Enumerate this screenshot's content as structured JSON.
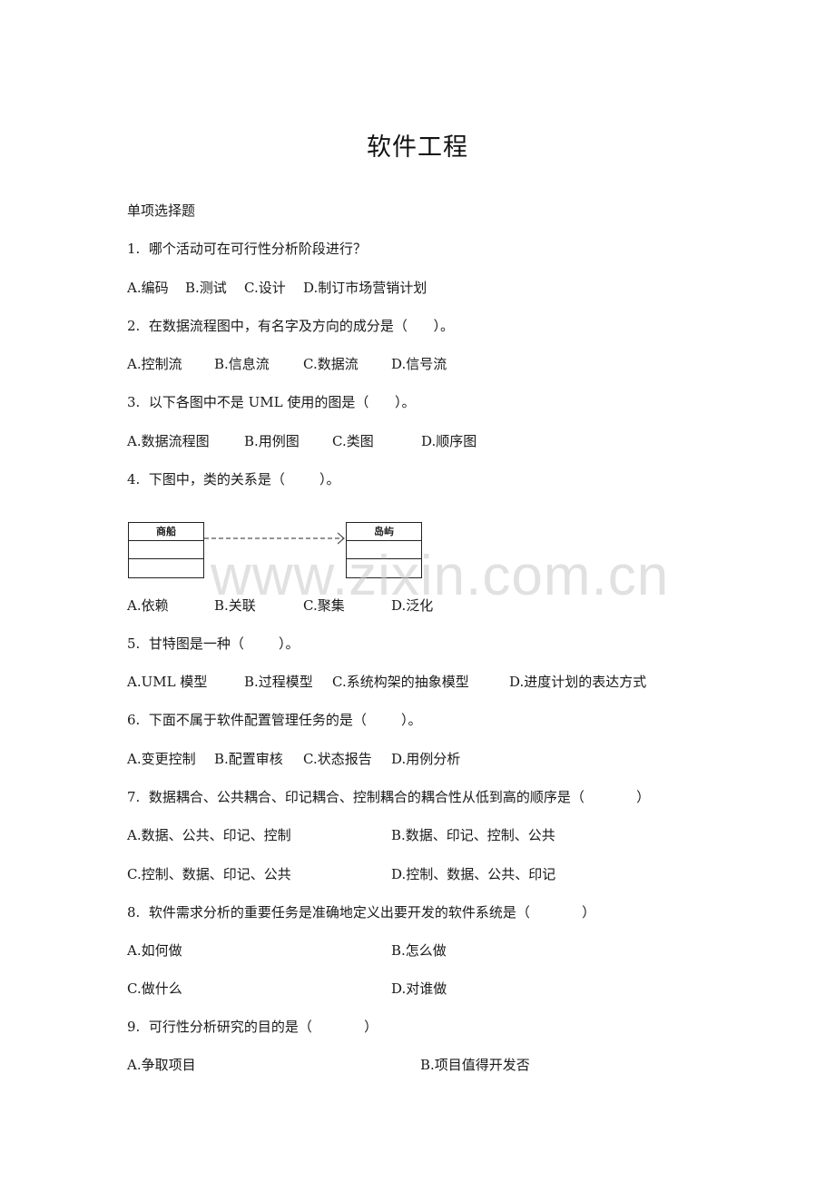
{
  "document": {
    "title": "软件工程",
    "section_heading": "单项选择题",
    "watermark": "www.zixin.com.cn",
    "questions": [
      {
        "stem": "1.  哪个活动可在可行性分析阶段进行？",
        "options": [
          "A.编码",
          "B.测试",
          "C.设计",
          "D.制订市场营销计划"
        ]
      },
      {
        "stem": "2.  在数据流程图中，有名字及方向的成分是（      ）。",
        "options": [
          "A.控制流",
          "B.信息流",
          "C.数据流",
          "D.信号流"
        ]
      },
      {
        "stem": "3.  以下各图中不是 UML 使用的图是（      ）。",
        "options": [
          "A.数据流程图",
          "B.用例图",
          "C.类图",
          "D.顺序图"
        ]
      },
      {
        "stem": "4.  下图中，类的关系是（        ）。",
        "diagram": {
          "source_class": "商船",
          "target_class": "岛屿",
          "relationship_line": "dashed-open-arrow"
        },
        "options": [
          "A.依赖",
          "B.关联",
          "C.聚集",
          "D.泛化"
        ]
      },
      {
        "stem": "5.  甘特图是一种（        ）。",
        "options": [
          "A.UML 模型",
          "B.过程模型",
          "C.系统构架的抽象模型",
          "D.进度计划的表达方式"
        ]
      },
      {
        "stem": "6.  下面不属于软件配置管理任务的是（        ）。",
        "options": [
          "A.变更控制",
          "B.配置审核",
          "C.状态报告",
          "D.用例分析"
        ]
      },
      {
        "stem": "7.  数据耦合、公共耦合、印记耦合、控制耦合的耦合性从低到高的顺序是（            ）",
        "options": [
          "A.数据、公共、印记、控制",
          "B.数据、印记、控制、公共",
          "C.控制、数据、印记、公共",
          "D.控制、数据、公共、印记"
        ]
      },
      {
        "stem": "8.  软件需求分析的重要任务是准确地定义出要开发的软件系统是（            ）",
        "options": [
          "A.如何做",
          "B.怎么做",
          "C.做什么",
          "D.对谁做"
        ]
      },
      {
        "stem": "9.  可行性分析研究的目的是（            ）",
        "options": [
          "A.争取项目",
          "B.项目值得开发否"
        ]
      }
    ]
  }
}
